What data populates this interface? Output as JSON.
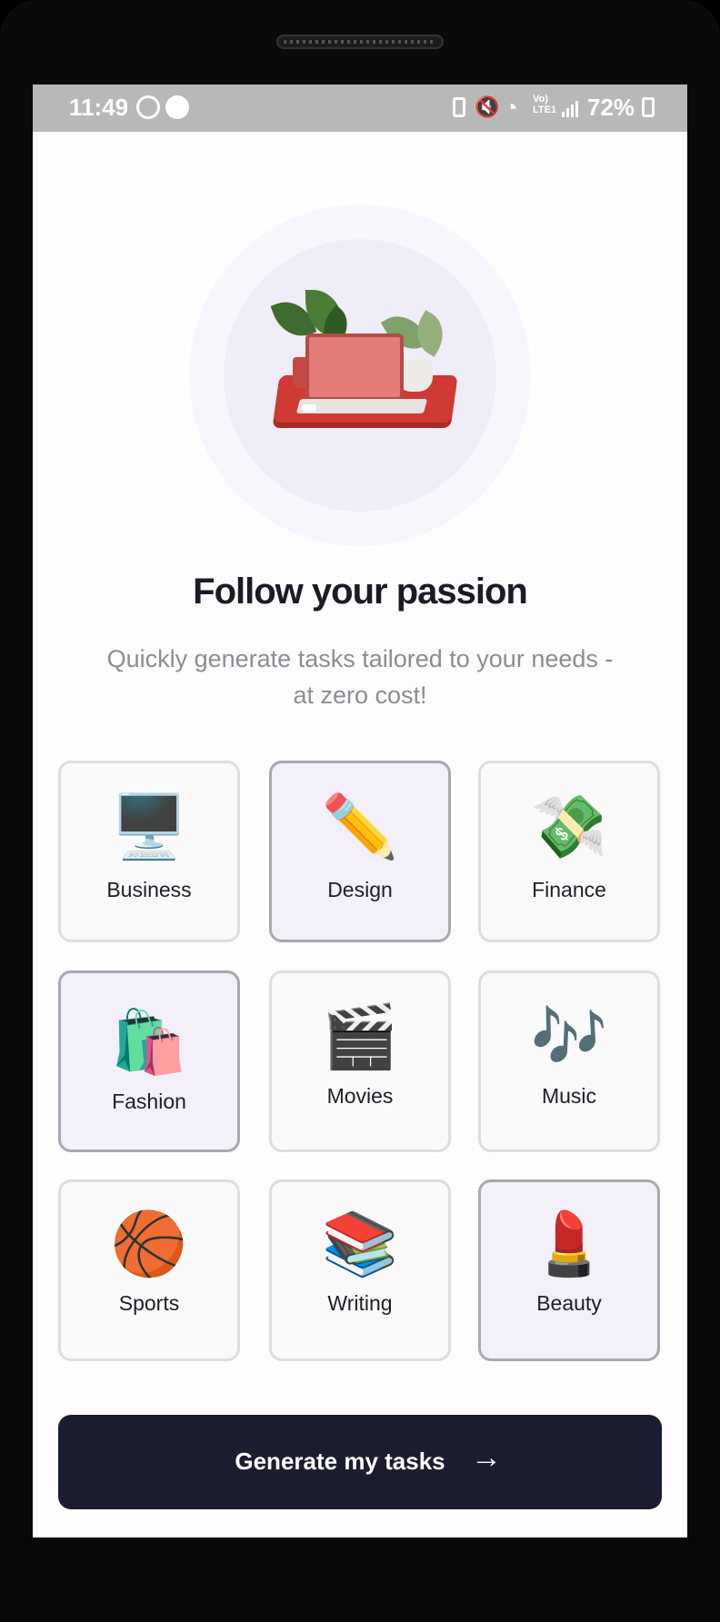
{
  "status_bar": {
    "time": "11:49",
    "battery": "72%",
    "network_label": "Vo)\nLTE1"
  },
  "hero": {
    "title": "Follow your passion",
    "subtitle": "Quickly generate tasks tailored to your needs - at zero cost!"
  },
  "categories": [
    {
      "label": "Business",
      "emoji": "🖥️",
      "icon": "computer-monitor-icon",
      "selected": false
    },
    {
      "label": "Design",
      "emoji": "✏️",
      "icon": "pencil-icon",
      "selected": true
    },
    {
      "label": "Finance",
      "emoji": "💸",
      "icon": "money-with-wings-icon",
      "selected": false
    },
    {
      "label": "Fashion",
      "emoji": "🛍️",
      "icon": "shopping-bags-icon",
      "selected": true
    },
    {
      "label": "Movies",
      "emoji": "🎬",
      "icon": "clapper-board-icon",
      "selected": false
    },
    {
      "label": "Music",
      "emoji": "🎶",
      "icon": "music-notes-icon",
      "selected": false
    },
    {
      "label": "Sports",
      "emoji": "🏀",
      "icon": "basketball-icon",
      "selected": false
    },
    {
      "label": "Writing",
      "emoji": "📚",
      "icon": "books-icon",
      "selected": false
    },
    {
      "label": "Beauty",
      "emoji": "💄",
      "icon": "lipstick-icon",
      "selected": true
    }
  ],
  "cta": {
    "label": "Generate my tasks",
    "arrow": "→"
  },
  "colors": {
    "background": "#fffcfe",
    "selected_card": "#f3f0fa",
    "card": "#fafafa",
    "cta": "#1c1c30",
    "status_bar": "#b8b8b8"
  }
}
